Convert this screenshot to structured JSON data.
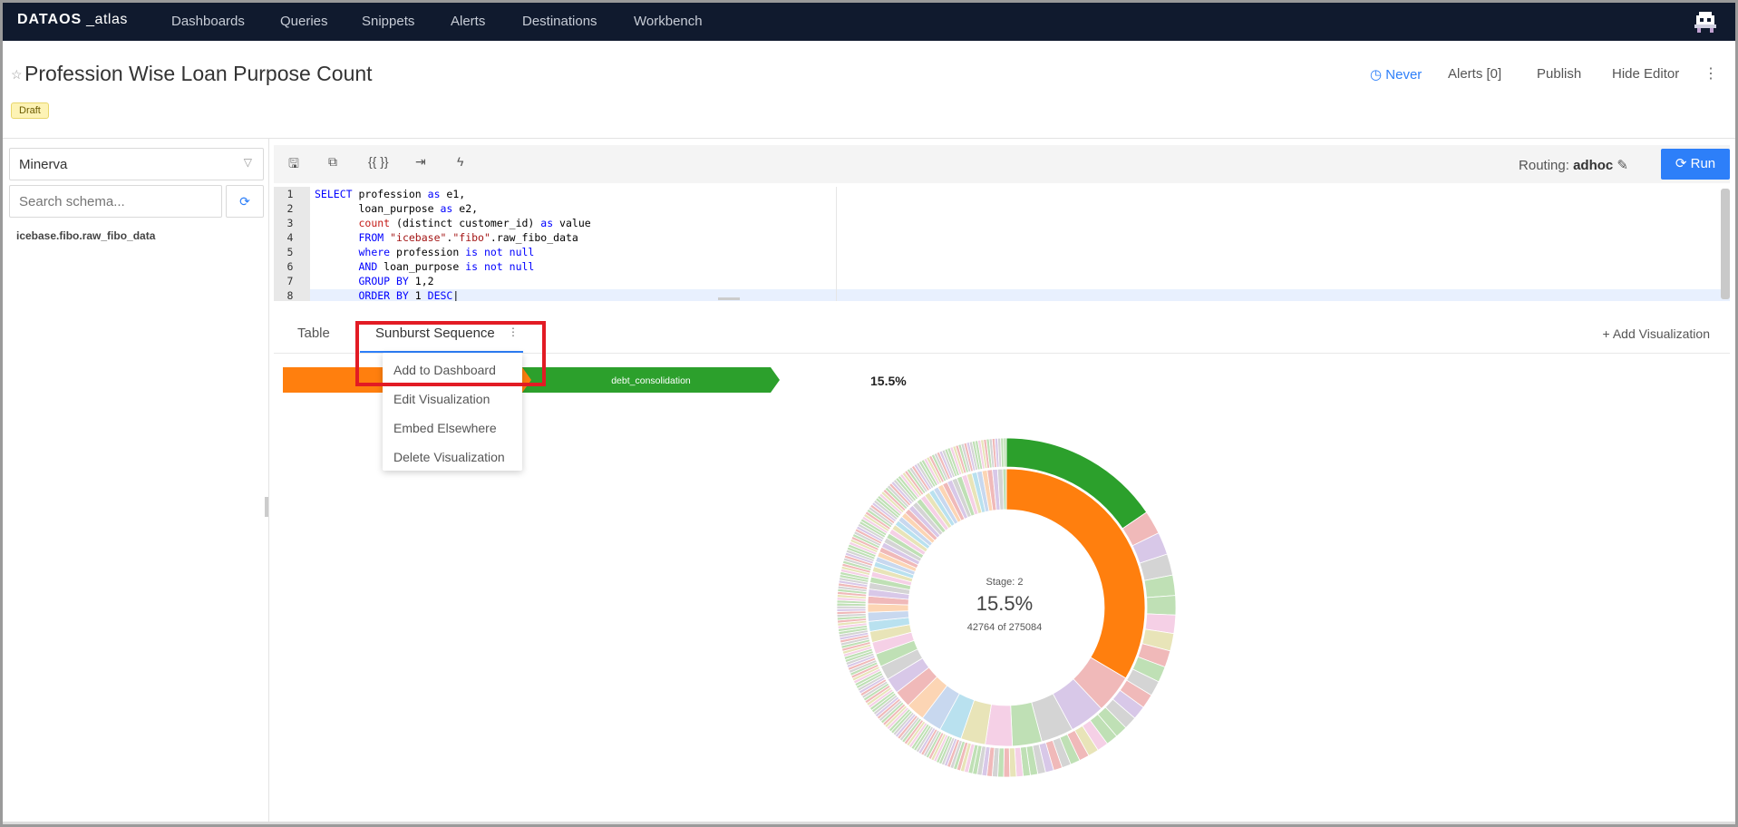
{
  "nav": {
    "brand_strong": "DATAOS",
    "brand_suffix": "_atlas",
    "items": [
      "Dashboards",
      "Queries",
      "Snippets",
      "Alerts",
      "Destinations",
      "Workbench"
    ]
  },
  "header": {
    "title": "Profession Wise Loan Purpose Count",
    "status_badge": "Draft",
    "refresh_schedule": "Never",
    "alerts": "Alerts [0]",
    "publish": "Publish",
    "hide_editor": "Hide Editor"
  },
  "sidebar": {
    "datasource": "Minerva",
    "search_placeholder": "Search schema...",
    "schema_items": [
      "icebase.fibo.raw_fibo_data"
    ]
  },
  "toolbar": {
    "routing_label": "Routing:",
    "routing_value": "adhoc",
    "run_label": "Run"
  },
  "editor": {
    "line_numbers": [
      "1",
      "2",
      "3",
      "4",
      "5",
      "6",
      "7",
      "8"
    ]
  },
  "tabs": {
    "items": [
      "Table",
      "Sunburst Sequence"
    ],
    "active": "Sunburst Sequence",
    "add_visualization": "+ Add Visualization"
  },
  "context_menu": {
    "items": [
      "Add to Dashboard",
      "Edit Visualization",
      "Embed Elsewhere",
      "Delete Visualization"
    ]
  },
  "sunburst": {
    "breadcrumb": [
      "",
      "debt_consolidation"
    ],
    "breadcrumb_pct": "15.5%",
    "center_stage": "Stage: 2",
    "center_pct": "15.5%",
    "center_count": "42764 of 275084",
    "colors": {
      "orange": "#ff7f0e",
      "green": "#2ca02c",
      "pink": "#f0b9b9",
      "lavender": "#d8c8e8",
      "lightgreen": "#bfe0b5",
      "grey": "#d4d4d4"
    }
  }
}
